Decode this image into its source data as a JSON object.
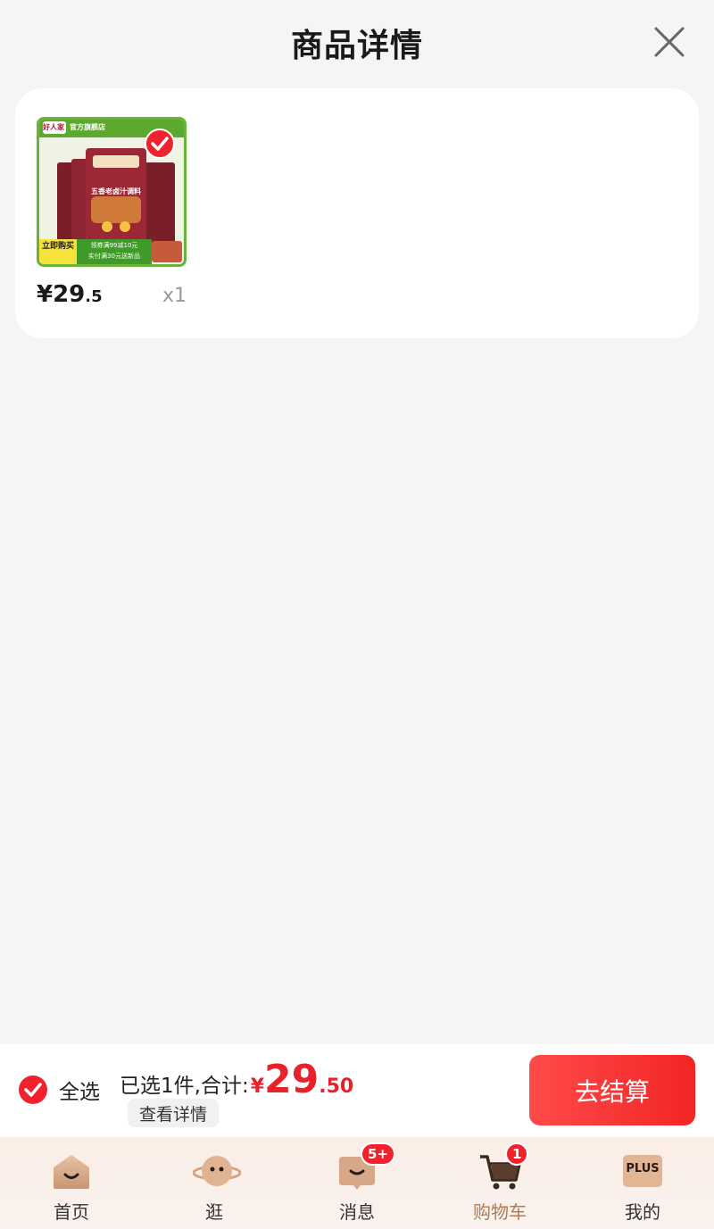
{
  "header": {
    "title": "商品详情"
  },
  "product": {
    "brand_badge": "好人家",
    "store_tag": "官方旗舰店",
    "package_title": "五香老卤汁调料",
    "buy_now_tag": "立即购买",
    "coupon_line1": "领券满99减10元",
    "coupon_line2": "实付满30元送新品",
    "price_main": "¥29",
    "price_decimal": ".5",
    "quantity": "x1",
    "selected": true
  },
  "checkout": {
    "select_all_label": "全选",
    "summary_label": "已选1件,合计:",
    "currency": "¥",
    "total_int": "29",
    "total_dec": ".50",
    "details_label": "查看详情",
    "pay_label": "去结算"
  },
  "tabbar": {
    "items": [
      {
        "label": "首页",
        "icon": "home-icon"
      },
      {
        "label": "逛",
        "icon": "planet-face-icon"
      },
      {
        "label": "消息",
        "icon": "message-icon",
        "badge": "5+"
      },
      {
        "label": "购物车",
        "icon": "cart-icon",
        "badge": "1",
        "active": true
      },
      {
        "label": "我的",
        "icon": "plus-member-icon",
        "icon_text": "PLUS"
      }
    ]
  },
  "colors": {
    "accent": "#f22525",
    "price": "#e8222a",
    "tab_active": "#b07a52"
  }
}
